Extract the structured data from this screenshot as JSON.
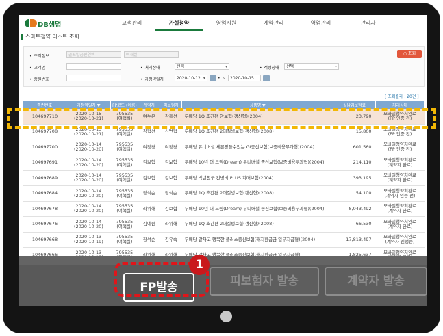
{
  "logo_text": "DB생명",
  "nav": [
    "고객관리",
    "가설청약",
    "영업지원",
    "계약관리",
    "영업관리",
    "관리자"
  ],
  "page_title": "스마트청약 리스트 조회",
  "filter": {
    "org_label": "조직정보",
    "org_val1": "골프발급원연맥",
    "org_val2": "여재실",
    "customer_label": "고객명",
    "employee_label": "종원번호",
    "proc_status_label": "처리상태",
    "proc_status_val": "선택",
    "suit_status_label": "적성상태",
    "suit_status_val": "선택",
    "date_label": "가청약일자",
    "date_from": "2020-10-12",
    "date_to": "2020-10-15",
    "date_sep": "~",
    "search_label": "○ 조회"
  },
  "result_count": "[ 조회결과 : 20건 ]",
  "table": {
    "headers": [
      "증권번호",
      "가청약일자 ▼",
      "FP코드 (이름)",
      "계약자",
      "피보험자",
      "상품명 ▼",
      "실납입보험료",
      "처리상태"
    ],
    "rows": [
      {
        "no": "104697710",
        "date": "2020-10-15",
        "date2": "(2020-10-21)",
        "fp": "795535",
        "fp2": "(여핵실)",
        "c": "여누은",
        "i": "강홍선",
        "p": "무배당 1Q 초간편 암보험(갱신형)(2004)",
        "amt": "23,790",
        "st": "모바일청약처완료",
        "st2": "(FP 인증 전)"
      },
      {
        "no": "104697708",
        "date": "2020-10-15",
        "date2": "(2020-10-21)",
        "fp": "795535",
        "fp2": "(여핵실)",
        "c": "강혁선",
        "i": "신변혁",
        "p": "무배당 1Q 초간편 2대질병보험(갱신형)(2008)",
        "amt": "15,800",
        "st": "모바일청약처완료",
        "st2": "(FP 인증 전)"
      },
      {
        "no": "104697700",
        "date": "2020-10-14",
        "date2": "(2020-10-20)",
        "fp": "795535",
        "fp2": "(여핵실)",
        "c": "여정경",
        "i": "여정경",
        "p": "무배당 유니버셜 세븐팡플수있는 GI종신보험(보증비용부과형)(2004)",
        "amt": "601,560",
        "st": "모바일청약처완료",
        "st2": "(FP 인증 전)"
      },
      {
        "no": "104697691",
        "date": "2020-10-14",
        "date2": "(2020-10-20)",
        "fp": "795535",
        "fp2": "(여핵실)",
        "c": "김보험",
        "i": "김보험",
        "p": "무배당 10년 더 드림(Dream) 유니버셜 종신보험(보증비용부과형)(2004)",
        "amt": "214,110",
        "st": "모바일청약처완료",
        "st2": "(계약자 완료)"
      },
      {
        "no": "104697689",
        "date": "2020-10-14",
        "date2": "(2020-10-20)",
        "fp": "795535",
        "fp2": "(여핵실)",
        "c": "김보험",
        "i": "김보험",
        "p": "무배당 백년친구 간병비 PLUS 치매보험(2004)",
        "amt": "393,195",
        "st": "모바일청약처완료",
        "st2": "(계약자 완료)"
      },
      {
        "no": "104697684",
        "date": "2020-10-14",
        "date2": "(2020-10-20)",
        "fp": "795535",
        "fp2": "(여핵실)",
        "c": "장석순",
        "i": "장석순",
        "p": "무배당 1Q 초간편 2대질병보험(갱신형)(2008)",
        "amt": "54,100",
        "st": "모바일청약처완료",
        "st2": "(계약자 인증 전)"
      },
      {
        "no": "104697678",
        "date": "2020-10-14",
        "date2": "(2020-10-20)",
        "fp": "795535",
        "fp2": "(여핵실)",
        "c": "라위해",
        "i": "김보험",
        "p": "무배당 10년 더 드림(Dream) 유니버셜 종신보험(보증비용부과형)(2004)",
        "amt": "8,043,492",
        "st": "모바일청약처완료",
        "st2": "(계약자 완료)"
      },
      {
        "no": "104697676",
        "date": "2020-10-14",
        "date2": "(2020-10-20)",
        "fp": "795535",
        "fp2": "(여핵실)",
        "c": "김예원",
        "i": "라위해",
        "p": "무배당 1Q 초간편 2대질병보험(갱신형)(2008)",
        "amt": "66,530",
        "st": "모바일청약처완료",
        "st2": "(계약자 완료)"
      },
      {
        "no": "104697668",
        "date": "2020-10-13",
        "date2": "(2020-10-19)",
        "fp": "795535",
        "fp2": "(여핵실)",
        "c": "장석순",
        "i": "김유숙",
        "p": "무배당 알차고 행복한 플러스종신보험(해지환급금 일부지급형)(2004)",
        "amt": "17,813,497",
        "st": "모바일청약처완료",
        "st2": "(계약자 진행중)"
      },
      {
        "no": "104697666",
        "date": "2020-10-13",
        "date2": "(2020-10-19)",
        "fp": "795535",
        "fp2": "(여핵실)",
        "c": "라위해",
        "i": "라위해",
        "p": "무배당 알차고 행복한 플러스종신보험(해지환급금 일부지급형)",
        "amt": "1,825,637",
        "st": "모바일청약처완료",
        "st2": "(계약자 완료)"
      }
    ]
  },
  "buttons": {
    "fp": "FP발송",
    "insured": "피보험자 발송",
    "contractor": "계약자 발송"
  },
  "badge": "1",
  "colors": {
    "brand_green": "#1a7a3c",
    "header_blue": "#7fa8d2",
    "highlight_yellow": "#f2b705",
    "callout_red": "#e0151a"
  }
}
